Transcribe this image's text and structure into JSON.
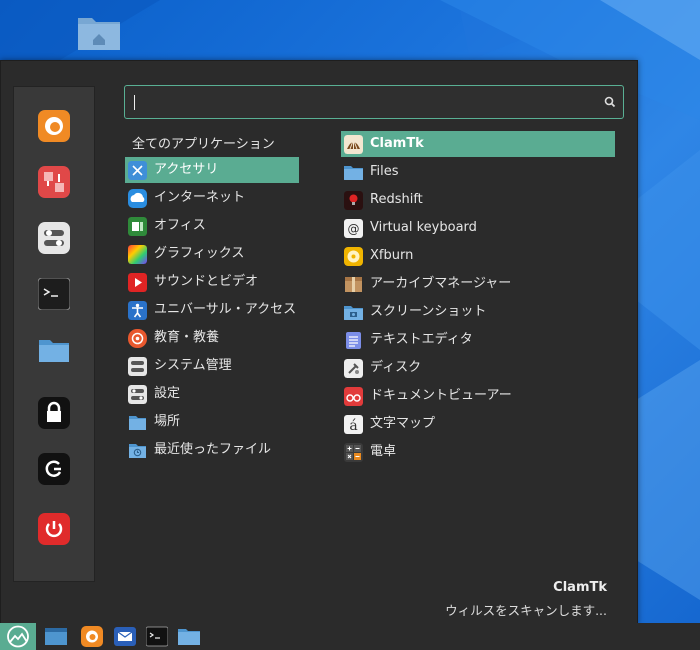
{
  "menu": {
    "search": {
      "value": "",
      "placeholder": ""
    },
    "categories_header": "全てのアプリケーション",
    "categories": [
      {
        "label": "アクセサリ",
        "icon": "accessories-icon",
        "selected": true
      },
      {
        "label": "インターネット",
        "icon": "internet-icon"
      },
      {
        "label": "オフィス",
        "icon": "office-icon"
      },
      {
        "label": "グラフィックス",
        "icon": "graphics-icon"
      },
      {
        "label": "サウンドとビデオ",
        "icon": "sound-video-icon"
      },
      {
        "label": "ユニバーサル・アクセス",
        "icon": "universal-access-icon"
      },
      {
        "label": "教育・教養",
        "icon": "education-icon"
      },
      {
        "label": "システム管理",
        "icon": "administration-icon"
      },
      {
        "label": "設定",
        "icon": "preferences-icon"
      },
      {
        "label": "場所",
        "icon": "places-folder-icon"
      },
      {
        "label": "最近使ったファイル",
        "icon": "recent-files-icon"
      }
    ],
    "apps": [
      {
        "label": "ClamTk",
        "icon": "clamtk-icon",
        "selected": true
      },
      {
        "label": "Files",
        "icon": "files-folder-icon"
      },
      {
        "label": "Redshift",
        "icon": "redshift-icon"
      },
      {
        "label": "Virtual keyboard",
        "icon": "virtual-keyboard-icon"
      },
      {
        "label": "Xfburn",
        "icon": "xfburn-disc-icon"
      },
      {
        "label": "アーカイブマネージャー",
        "icon": "archive-manager-icon"
      },
      {
        "label": "スクリーンショット",
        "icon": "screenshot-icon"
      },
      {
        "label": "テキストエディタ",
        "icon": "text-editor-icon"
      },
      {
        "label": "ディスク",
        "icon": "disks-icon"
      },
      {
        "label": "ドキュメントビューアー",
        "icon": "document-viewer-icon"
      },
      {
        "label": "文字マップ",
        "icon": "character-map-icon"
      },
      {
        "label": "電卓",
        "icon": "calculator-icon"
      }
    ],
    "description": {
      "title": "ClamTk",
      "text": "ウィルスをスキャンします..."
    },
    "favorites": [
      "firefox-icon",
      "software-manager-icon",
      "settings-toggle-icon",
      "terminal-icon",
      "files-folder-icon",
      "lock-screen-icon",
      "logout-icon",
      "power-icon"
    ]
  },
  "taskbar": {
    "items": [
      "menu-logo-icon",
      "show-desktop-icon",
      "firefox-icon",
      "mail-icon",
      "terminal-icon",
      "files-folder-icon"
    ]
  },
  "colors": {
    "accent": "#5aac92",
    "menu_bg": "#2b2b2b",
    "panel_bg": "#393939"
  }
}
